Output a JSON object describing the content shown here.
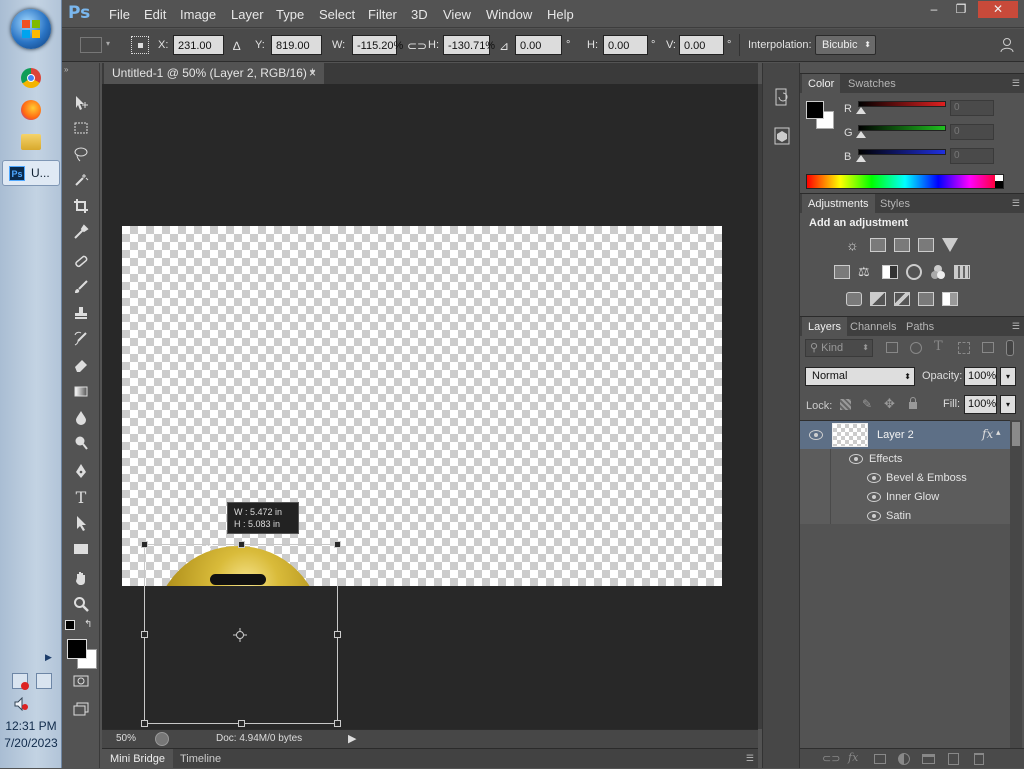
{
  "taskbar": {
    "ps_task_label": "U...",
    "time": "12:31 PM",
    "date": "7/20/2023"
  },
  "app": {
    "logo": "Ps",
    "menus": [
      "File",
      "Edit",
      "Image",
      "Layer",
      "Type",
      "Select",
      "Filter",
      "3D",
      "View",
      "Window",
      "Help"
    ],
    "window_controls": [
      "–",
      "❐",
      "✕"
    ]
  },
  "options": {
    "x_label": "X:",
    "x_value": "231.00 px",
    "y_label": "Y:",
    "y_value": "819.00 px",
    "w_label": "W:",
    "w_value": "-115.20%",
    "h_label": "H:",
    "h_value": "-130.71%",
    "angle_value": "0.00",
    "angle_unit": "°",
    "hskew_label": "H:",
    "hskew_value": "0.00",
    "hskew_unit": "°",
    "vskew_label": "V:",
    "vskew_value": "0.00",
    "vskew_unit": "°",
    "interpolation_label": "Interpolation:",
    "interpolation_value": "Bicubic"
  },
  "document": {
    "tab_title": "Untitled-1 @ 50% (Layer 2, RGB/16) *",
    "tab_close": "×",
    "zoom": "50%",
    "doc_info": "Doc: 4.94M/0 bytes",
    "transform_tip_w": "W :  5.472 in",
    "transform_tip_h": "H :  5.083 in"
  },
  "bottom_tabs": [
    "Mini Bridge",
    "Timeline"
  ],
  "color_panel": {
    "tabs": [
      "Color",
      "Swatches"
    ],
    "channels": [
      {
        "label": "R",
        "value": "0",
        "color": "#e02020"
      },
      {
        "label": "G",
        "value": "0",
        "color": "#20c020"
      },
      {
        "label": "B",
        "value": "0",
        "color": "#2030e0"
      }
    ]
  },
  "adjustments_panel": {
    "tabs": [
      "Adjustments",
      "Styles"
    ],
    "heading": "Add an adjustment"
  },
  "layers_panel": {
    "tabs": [
      "Layers",
      "Channels",
      "Paths"
    ],
    "filter_kind": "Kind",
    "blend_mode": "Normal",
    "opacity_label": "Opacity:",
    "opacity_value": "100%",
    "lock_label": "Lock:",
    "fill_label": "Fill:",
    "fill_value": "100%",
    "layer_name": "Layer 2",
    "fx_label": "fx",
    "effects_label": "Effects",
    "effects": [
      "Bevel & Emboss",
      "Inner Glow",
      "Satin"
    ]
  },
  "colors": {
    "accent": "#7ab7ee",
    "selected_layer": "#5d6f86",
    "coin_yellow": "#c9a72a"
  }
}
